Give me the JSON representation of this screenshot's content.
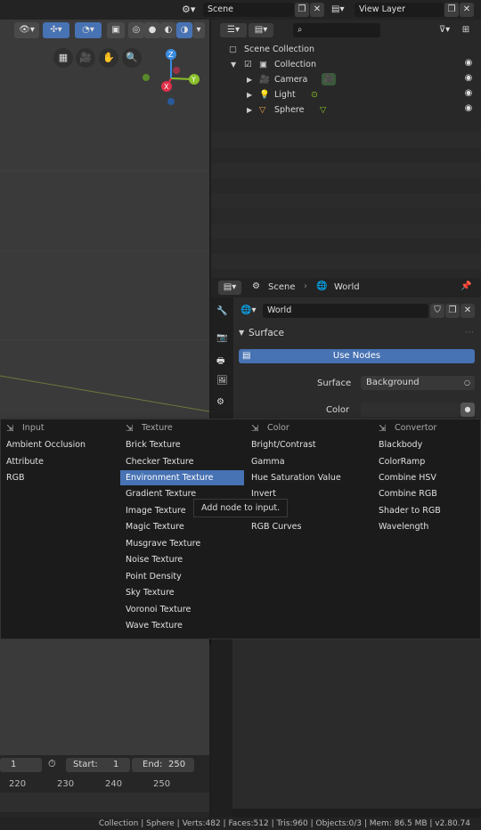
{
  "topbar": {
    "scene_value": "Scene",
    "view_layer_value": "View Layer"
  },
  "outliner": {
    "search_placeholder": "",
    "items": [
      {
        "label": "Scene Collection"
      },
      {
        "label": "Collection"
      },
      {
        "label": "Camera"
      },
      {
        "label": "Light"
      },
      {
        "label": "Sphere"
      }
    ]
  },
  "properties": {
    "breadcrumb_scene": "Scene",
    "breadcrumb_world": "World",
    "world_name": "World",
    "panel_surface": "Surface",
    "use_nodes": "Use Nodes",
    "surface_label": "Surface",
    "surface_value": "Background",
    "color_label": "Color"
  },
  "menu": {
    "columns": [
      {
        "header": "Input",
        "items": [
          "Ambient Occlusion",
          "Attribute",
          "RGB"
        ]
      },
      {
        "header": "Texture",
        "items": [
          "Brick Texture",
          "Checker Texture",
          "Environment Texture",
          "Gradient Texture",
          "Image Texture",
          "Magic Texture",
          "Musgrave Texture",
          "Noise Texture",
          "Point Density",
          "Sky Texture",
          "Voronoi Texture",
          "Wave Texture"
        ]
      },
      {
        "header": "Color",
        "items": [
          "Bright/Contrast",
          "Gamma",
          "Hue Saturation Value",
          "Invert",
          "",
          "RGB Curves"
        ]
      },
      {
        "header": "Convertor",
        "items": [
          "Blackbody",
          "ColorRamp",
          "Combine HSV",
          "Combine RGB",
          "Shader to RGB",
          "Wavelength"
        ]
      }
    ],
    "active_item": "Environment Texture",
    "tooltip": "Add node to input."
  },
  "timeline": {
    "current_frame": "1",
    "start_label": "Start:",
    "start_value": "1",
    "end_label": "End:",
    "end_value": "250",
    "ticks": [
      "220",
      "230",
      "240",
      "250"
    ]
  },
  "status": {
    "text": "Collection | Sphere | Verts:482 | Faces:512 | Tris:960 | Objects:0/3 | Mem: 86.5 MB | v2.80.74"
  },
  "colors": {
    "accent": "#4772b3",
    "axis_x": "#e0304a",
    "axis_y": "#8bc02a",
    "axis_z": "#3a8ae0"
  }
}
